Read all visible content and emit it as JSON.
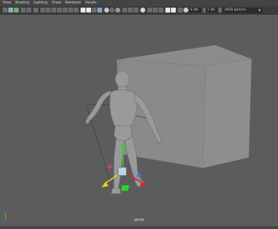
{
  "menu": [
    "View",
    "Shading",
    "Lighting",
    "Show",
    "Renderer",
    "Panels"
  ],
  "toolbar": {
    "exposure_value": "0.00",
    "gamma_value": "1.00",
    "color_space": "sRGB gamma"
  },
  "viewport": {
    "camera_name": "persp"
  },
  "colors": {
    "background": "#5c5c5c",
    "menubar": "#444444",
    "toolbar": "#3c3c3c",
    "axis_x": "#e02020",
    "axis_y": "#2ad62a",
    "axis_z": "#2a6ae0",
    "selection": "#7a9cff"
  },
  "icons": [
    "select-icon",
    "move-icon",
    "rotate-icon",
    "scale-icon",
    "camera-icon",
    "grid-icon",
    "wireframe-icon",
    "smooth-shade-icon",
    "texture-icon",
    "light-icon",
    "shadow-icon",
    "ao-icon",
    "aa-icon",
    "isolate-icon",
    "xray-icon",
    "gate-icon"
  ]
}
